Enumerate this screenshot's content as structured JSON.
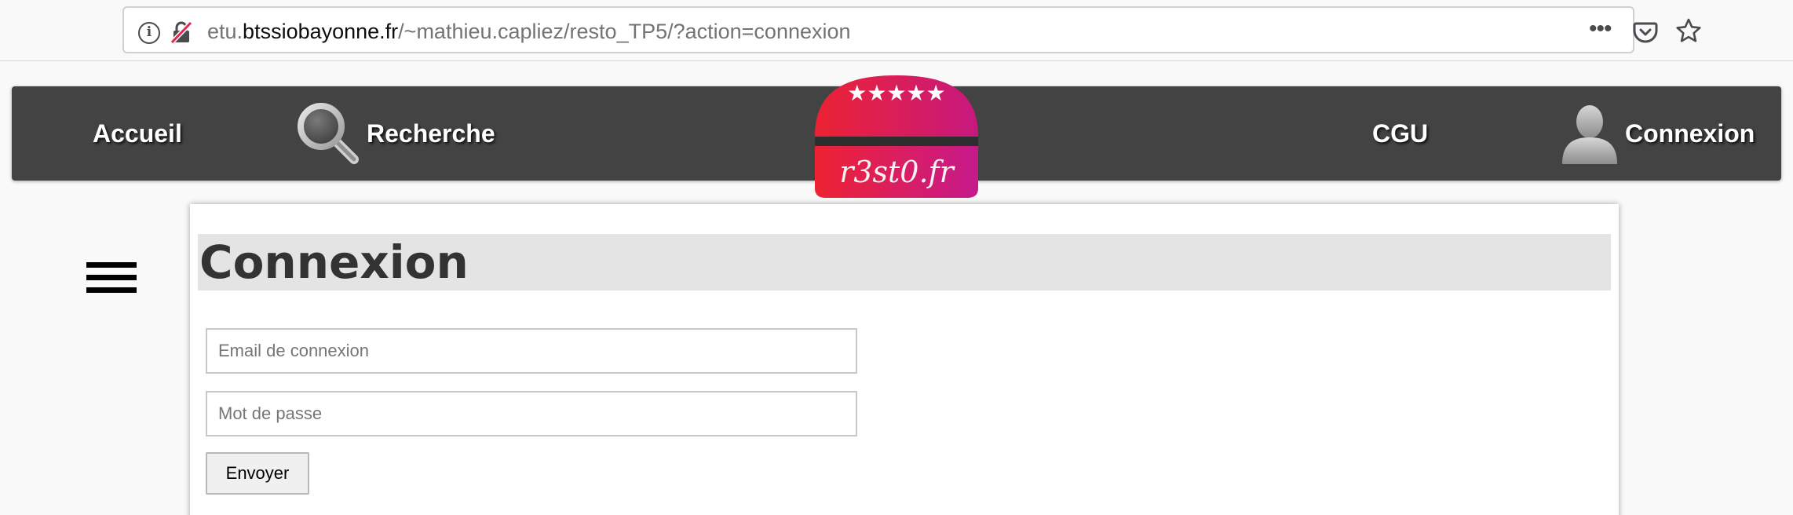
{
  "browser": {
    "url_prefix": "etu.",
    "url_host": "btssiobayonne.fr",
    "url_path": "/~mathieu.capliez/resto_TP5/?action=connexion",
    "more_label": "•••"
  },
  "nav": {
    "accueil": "Accueil",
    "recherche": "Recherche",
    "cgu": "CGU",
    "connexion": "Connexion"
  },
  "logo": {
    "text": "r3st0.fr",
    "stars": "★★★★★",
    "colors": {
      "top": "#e8223a",
      "mid": "#2a2a2a",
      "bottom": "#c81e86"
    }
  },
  "page": {
    "title": "Connexion",
    "email_placeholder": "Email de connexion",
    "password_placeholder": "Mot de passe",
    "submit_label": "Envoyer"
  },
  "icons": {
    "search": "search-icon",
    "user": "user-icon",
    "menu": "hamburger-menu-icon",
    "info": "info-icon",
    "lock": "insecure-lock-icon",
    "pocket": "pocket-icon",
    "star": "bookmark-star-icon"
  }
}
